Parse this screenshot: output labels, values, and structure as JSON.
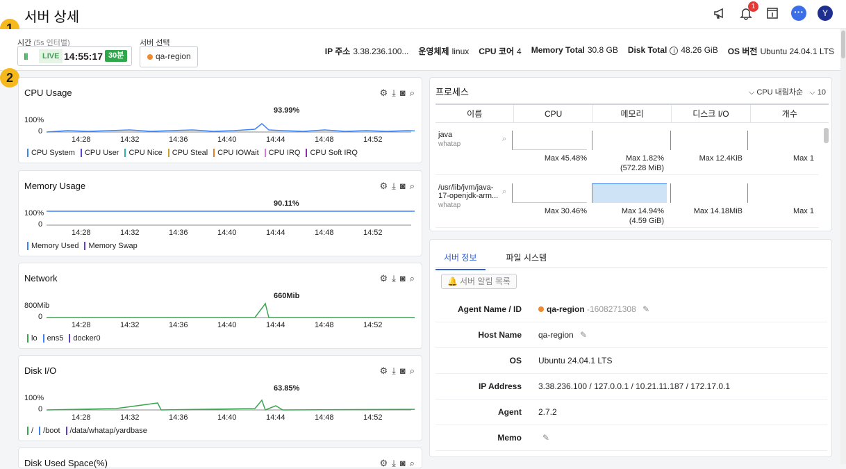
{
  "header": {
    "title": "서버 상세",
    "notification_count": "1",
    "avatar_initial": "Y"
  },
  "steps": [
    "1",
    "2"
  ],
  "controls": {
    "time_label": "시간",
    "time_interval": "(5s 인터벌)",
    "live_label": "LIVE",
    "live_time": "14:55:17",
    "live_range": "30분",
    "server_label": "서버 선택",
    "server_value": "qa-region"
  },
  "summary": [
    {
      "key": "IP 주소",
      "value": "3.38.236.100..."
    },
    {
      "key": "운영체제",
      "value": "linux"
    },
    {
      "key": "CPU 코어",
      "value": "4"
    },
    {
      "key": "Memory Total",
      "value": "30.8 GB"
    },
    {
      "key": "Disk Total",
      "value": "48.26 GiB"
    },
    {
      "key": "OS 버전",
      "value": "Ubuntu 24.04.1 LTS"
    }
  ],
  "x_ticks": [
    "14:28",
    "14:32",
    "14:36",
    "14:40",
    "14:44",
    "14:48",
    "14:52"
  ],
  "charts": [
    {
      "title": "CPU Usage",
      "y_max": "100%",
      "y_min": "0",
      "peak": "93.99%",
      "legend": [
        "CPU System",
        "CPU User",
        "CPU Nice",
        "CPU Steal",
        "CPU IOWait",
        "CPU IRQ",
        "CPU Soft IRQ"
      ],
      "legend_colors": [
        "#3b82f6",
        "#5b3fd6",
        "#2ab3b3",
        "#c9a227",
        "#e67e22",
        "#d873e0",
        "#8e2ca8"
      ]
    },
    {
      "title": "Memory Usage",
      "y_max": "100%",
      "y_min": "0",
      "peak": "90.11%",
      "legend": [
        "Memory Used",
        "Memory Swap"
      ],
      "legend_colors": [
        "#3b82f6",
        "#5b3fd6"
      ]
    },
    {
      "title": "Network",
      "y_max": "800Mib",
      "y_min": "0",
      "peak": "660Mib",
      "legend": [
        "lo",
        "ens5",
        "docker0"
      ],
      "legend_colors": [
        "#3aa650",
        "#3b82f6",
        "#5b3fd6"
      ]
    },
    {
      "title": "Disk I/O",
      "y_max": "100%",
      "y_min": "0",
      "peak": "63.85%",
      "legend": [
        "/",
        "/boot",
        "/data/whatap/yardbase"
      ],
      "legend_colors": [
        "#3aa650",
        "#3b82f6",
        "#5b3fd6"
      ]
    },
    {
      "title": "Disk Used Space(%)"
    }
  ],
  "processes": {
    "title": "프로세스",
    "sort": "CPU 내림차순",
    "limit": "10",
    "columns": [
      "이름",
      "CPU",
      "메모리",
      "디스크 I/O",
      "개수"
    ],
    "rows": [
      {
        "name": "java",
        "user": "whatap",
        "cpu": "Max  45.48%",
        "mem": "Max  1.82%",
        "mem_sub": "(572.28 MiB)",
        "disk": "Max  12.4KiB",
        "count": "Max  1"
      },
      {
        "name": "/usr/lib/jvm/java-17-openjdk-arm...",
        "user": "whatap",
        "cpu": "Max  30.46%",
        "mem": "Max  14.94%",
        "mem_sub": "(4.59 GiB)",
        "disk": "Max  14.18MiB",
        "count": "Max  1"
      }
    ]
  },
  "server_info": {
    "tabs": [
      "서버 정보",
      "파일 시스템"
    ],
    "alert_button": "서버 알림 목록",
    "rows": [
      {
        "key": "Agent Name / ID",
        "value": "qa-region",
        "sub": "-1608271308"
      },
      {
        "key": "Host Name",
        "value": "qa-region"
      },
      {
        "key": "OS",
        "value": "Ubuntu 24.04.1 LTS"
      },
      {
        "key": "IP Address",
        "value": "3.38.236.100 / 127.0.0.1 / 10.21.11.187 / 172.17.0.1"
      },
      {
        "key": "Agent",
        "value": "2.7.2"
      },
      {
        "key": "Memo",
        "value": ""
      }
    ]
  }
}
